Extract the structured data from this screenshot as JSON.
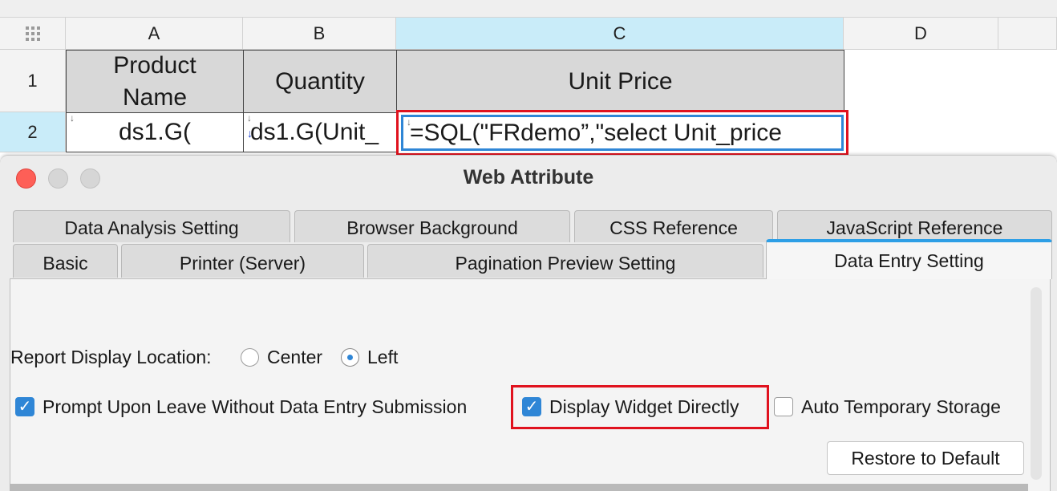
{
  "sheet": {
    "columns": [
      "A",
      "B",
      "C",
      "D"
    ],
    "rows": [
      "1",
      "2"
    ],
    "header_cells": {
      "a": "Product Name",
      "b": "Quantity",
      "c": "Unit Price"
    },
    "row2": {
      "a": "ds1.G(",
      "b": "ds1.G(Unit_",
      "c": "=SQL(\"FRdemo”,\"select Unit_price"
    }
  },
  "dialog": {
    "title": "Web Attribute",
    "tabs_row1": [
      "Data Analysis Setting",
      "Browser Background",
      "CSS Reference",
      "JavaScript Reference"
    ],
    "tabs_row2": [
      "Basic",
      "Printer (Server)",
      "Pagination Preview Setting",
      "Data Entry Setting"
    ],
    "active_tab": "Data Entry Setting",
    "report_display": {
      "label": "Report Display Location:",
      "options": [
        "Center",
        "Left"
      ],
      "selected": "Left"
    },
    "checkboxes": {
      "prompt_leave": {
        "label": "Prompt Upon Leave Without Data Entry Submission",
        "checked": true
      },
      "display_widget": {
        "label": "Display Widget Directly",
        "checked": true
      },
      "auto_storage": {
        "label": "Auto Temporary Storage",
        "checked": false
      }
    },
    "restore_button": "Restore to Default"
  },
  "colors": {
    "highlight": "#e0121e",
    "accent": "#2f86d6",
    "selected_header": "#c9ecf9"
  }
}
